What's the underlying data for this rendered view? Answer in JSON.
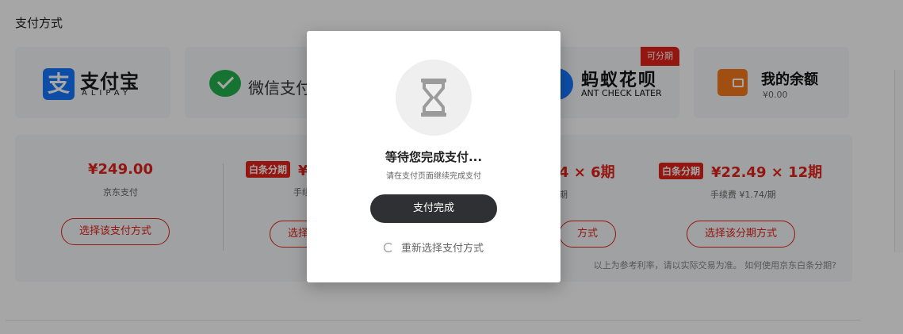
{
  "section_title": "支付方式",
  "methods": {
    "alipay": {
      "icon": "alipay-logo-icon",
      "glyph": "支",
      "name": "支付宝",
      "sub": "ALIPAY",
      "color": "#1677ff"
    },
    "wechat": {
      "icon": "wechat-pay-icon",
      "name": "微信支付",
      "color": "#22b14c"
    },
    "ant": {
      "icon": "ant-check-later-icon",
      "name": "蚂蚁花呗",
      "sub": "ANT CHECK LATER",
      "tag": "可分期"
    },
    "balance": {
      "icon": "wallet-icon",
      "name": "我的余额",
      "sub": "¥0.00"
    }
  },
  "plans": [
    {
      "price": "¥249.00",
      "desc": "京东支付",
      "button": "选择该支付方式"
    },
    {
      "badge": "白条分期",
      "price": "¥",
      "desc": "手续",
      "button": "选择"
    },
    {
      "price": "4 × 6期",
      "desc": "期",
      "button": "方式"
    },
    {
      "badge": "白条分期",
      "price": "¥22.49 × 12期",
      "desc": "手续费 ¥1.74/期",
      "button": "选择该分期方式"
    }
  ],
  "plan_note": "以上为参考利率，请以实际交易为准。 如何使用京东白条分期?",
  "modal": {
    "icon": "hourglass-icon",
    "title": "等待您完成支付...",
    "desc": "请在支付页面继续完成支付",
    "done_button": "支付完成",
    "reselect_icon": "refresh-icon",
    "reselect_label": "重新选择支付方式"
  },
  "colors": {
    "accent": "#e2231a",
    "dark_button": "#2f3033"
  }
}
